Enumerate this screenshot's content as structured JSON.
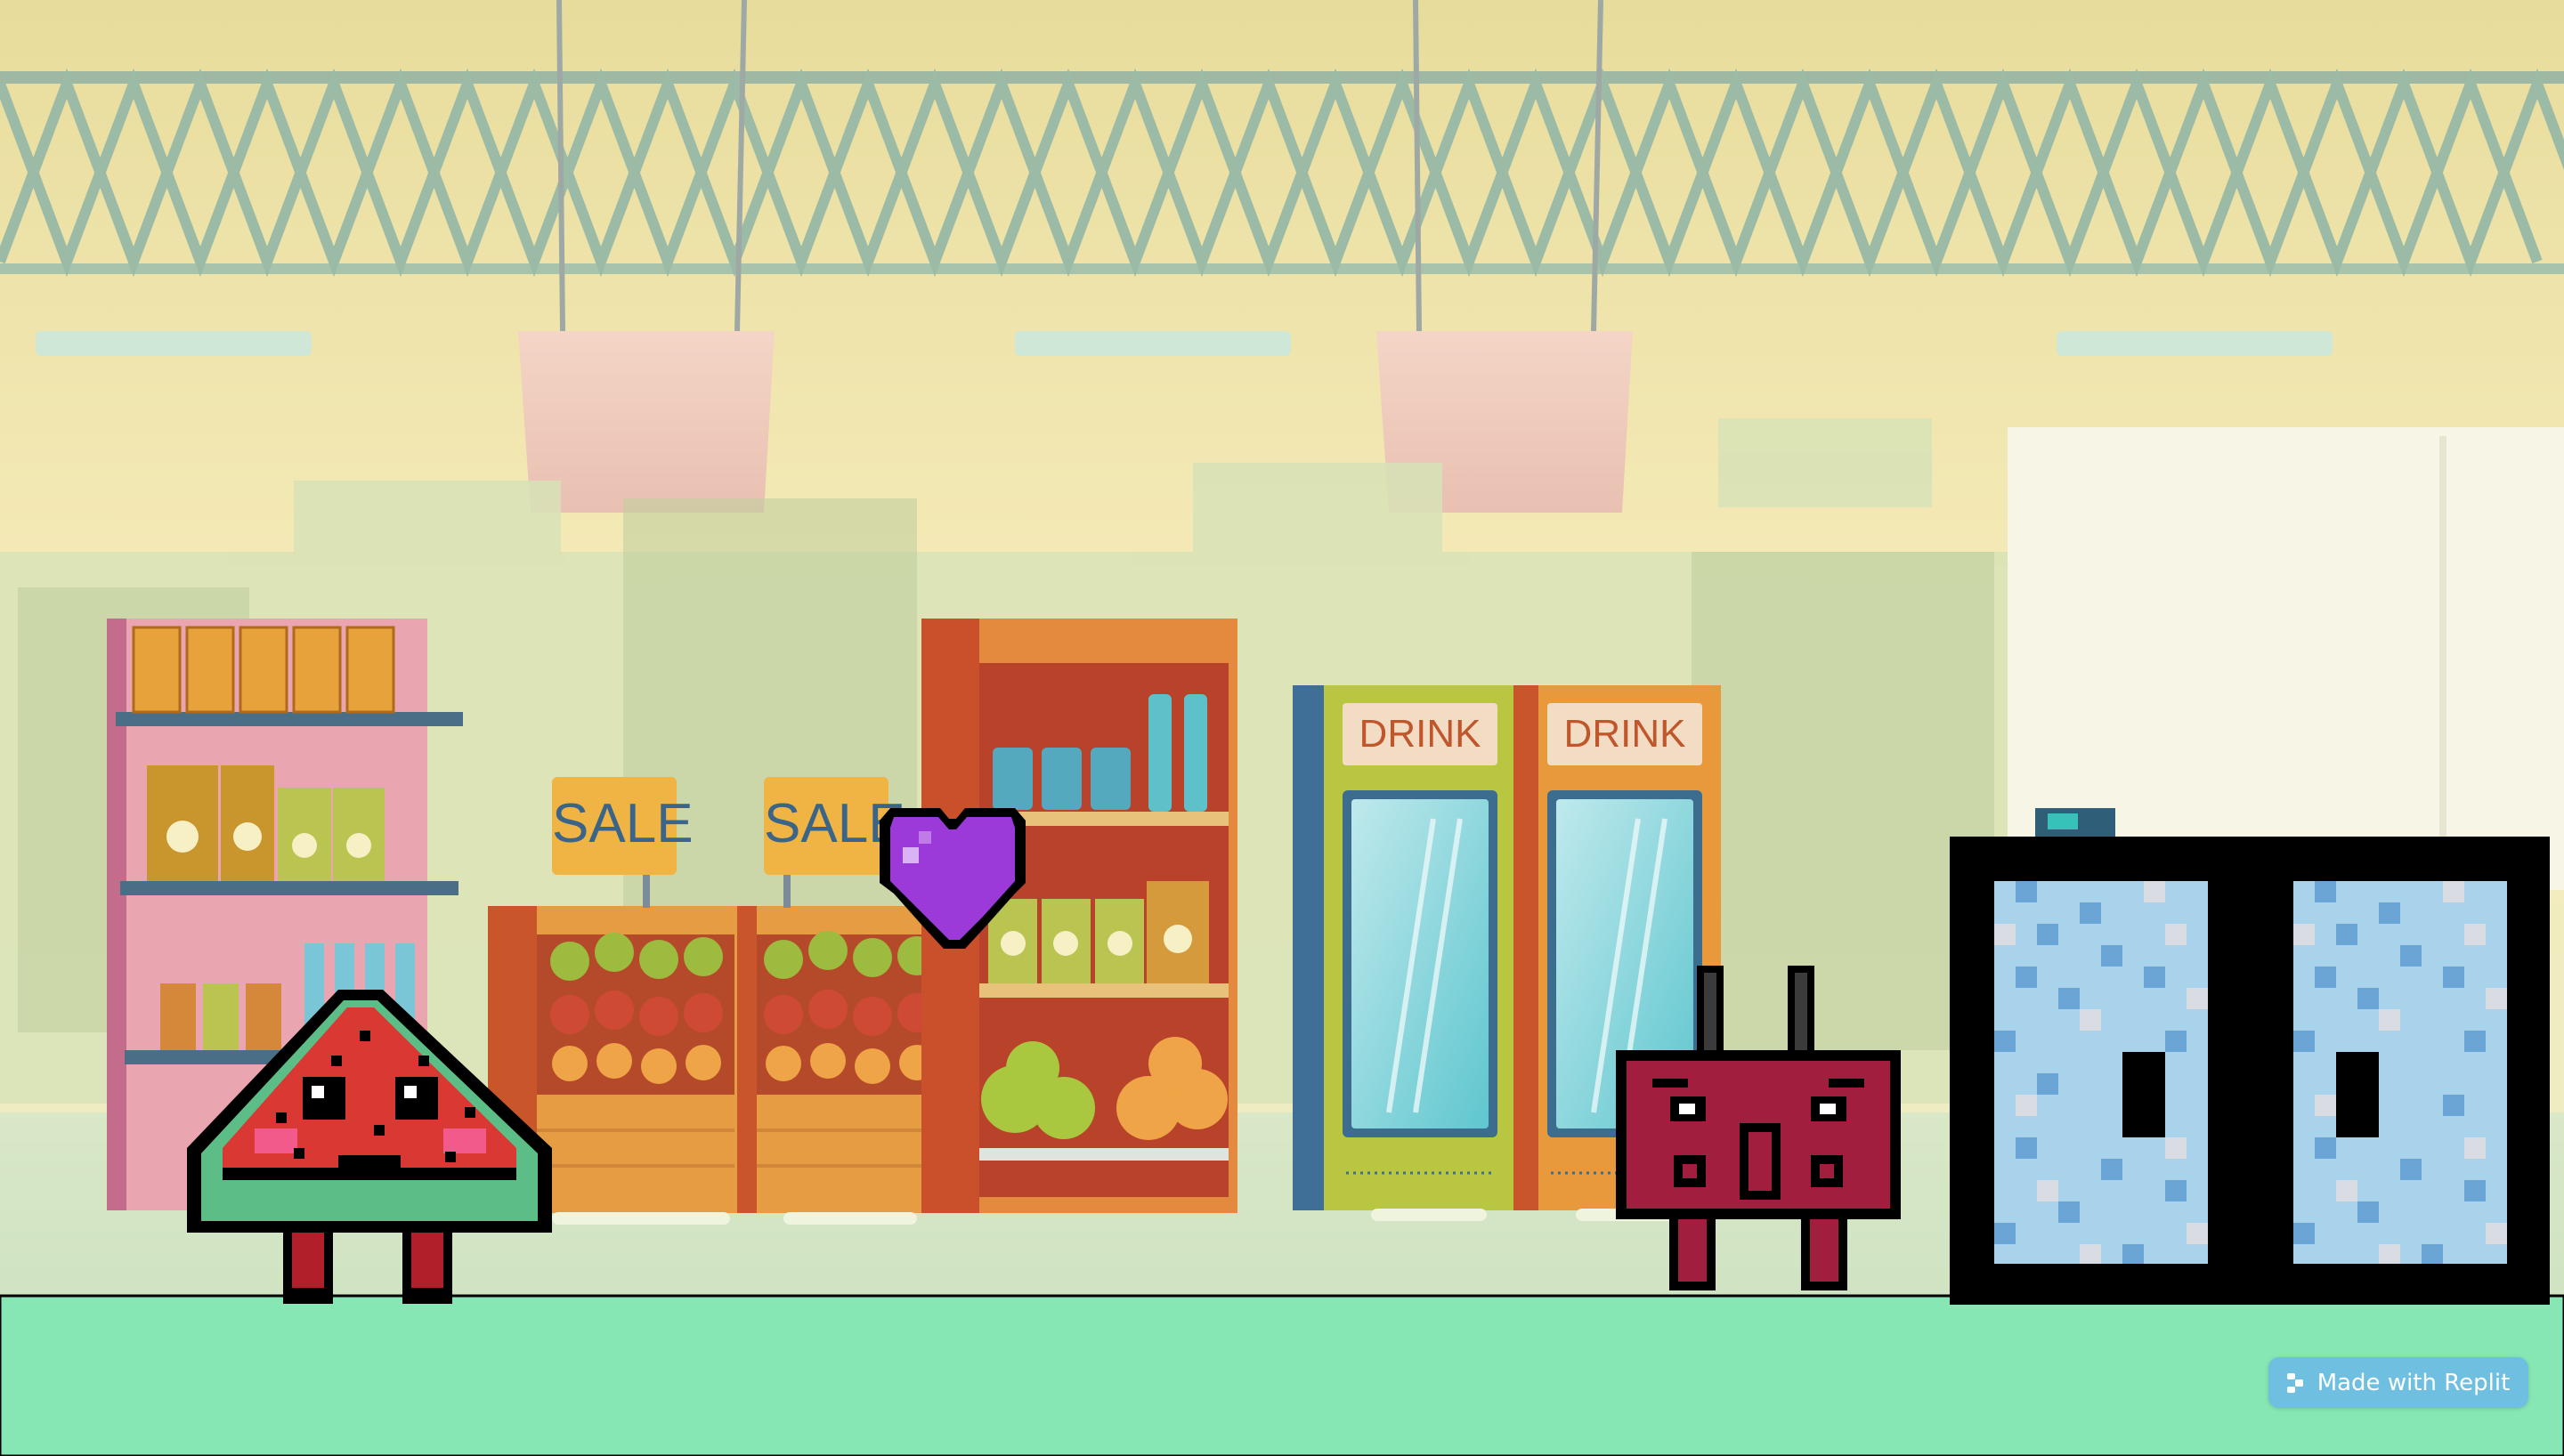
{
  "store": {
    "sale_label": "SALE",
    "drink_label": "DRINK"
  },
  "badge": {
    "label": "Made with Replit",
    "icon": "replit-logo-icon"
  },
  "colors": {
    "ground": "#86e6b4",
    "watermelon_red": "#d93833",
    "watermelon_rind": "#5dbd86",
    "heart_purple": "#9b3ad9",
    "rabbit_maroon": "#a11e3f",
    "counter_black": "#000000",
    "counter_checker": [
      "#a9d3ea",
      "#6aa5d6",
      "#d9dde3"
    ],
    "badge_blue": "#6fbfe0"
  },
  "sprites": {
    "watermelon": "watermelon-character",
    "heart": "purple-heart-pickup",
    "rabbit": "maroon-rabbit-enemy",
    "counter": "checkout-counter-block"
  }
}
